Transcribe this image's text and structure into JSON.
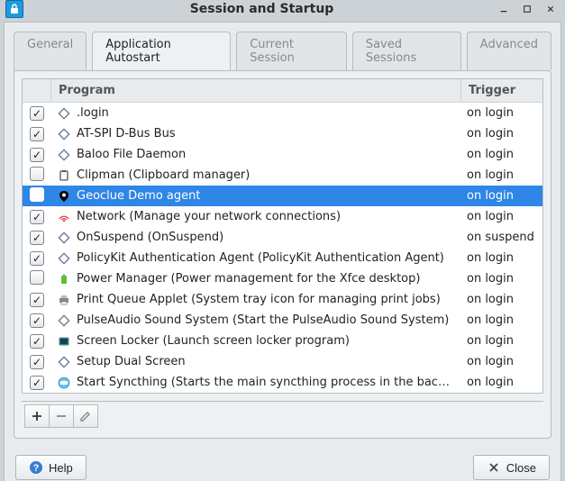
{
  "window": {
    "title": "Session and Startup"
  },
  "tabs": [
    {
      "label": "General",
      "active": false
    },
    {
      "label": "Application Autostart",
      "active": true
    },
    {
      "label": "Current Session",
      "active": false
    },
    {
      "label": "Saved Sessions",
      "active": false
    },
    {
      "label": "Advanced",
      "active": false
    }
  ],
  "columns": {
    "program": "Program",
    "trigger": "Trigger"
  },
  "rows": [
    {
      "checked": true,
      "icon": "generic",
      "label": ".login",
      "trigger": "on login",
      "selected": false
    },
    {
      "checked": true,
      "icon": "generic",
      "label": "AT-SPI D-Bus Bus",
      "trigger": "on login",
      "selected": false
    },
    {
      "checked": true,
      "icon": "generic",
      "label": "Baloo File Daemon",
      "trigger": "on login",
      "selected": false
    },
    {
      "checked": false,
      "icon": "clipman",
      "label": "Clipman (Clipboard manager)",
      "trigger": "on login",
      "selected": false
    },
    {
      "checked": false,
      "icon": "geoclue",
      "label": "Geoclue Demo agent",
      "trigger": "on login",
      "selected": true
    },
    {
      "checked": true,
      "icon": "network",
      "label": "Network (Manage your network connections)",
      "trigger": "on login",
      "selected": false
    },
    {
      "checked": true,
      "icon": "generic",
      "label": "OnSuspend (OnSuspend)",
      "trigger": "on suspend",
      "selected": false
    },
    {
      "checked": true,
      "icon": "generic",
      "label": "PolicyKit Authentication Agent (PolicyKit Authentication Agent)",
      "trigger": "on login",
      "selected": false
    },
    {
      "checked": false,
      "icon": "power",
      "label": "Power Manager (Power management for the Xfce desktop)",
      "trigger": "on login",
      "selected": false
    },
    {
      "checked": true,
      "icon": "printer",
      "label": "Print Queue Applet (System tray icon for managing print jobs)",
      "trigger": "on login",
      "selected": false
    },
    {
      "checked": true,
      "icon": "generic",
      "label": "PulseAudio Sound System (Start the PulseAudio Sound System)",
      "trigger": "on login",
      "selected": false
    },
    {
      "checked": true,
      "icon": "lock",
      "label": "Screen Locker (Launch screen locker program)",
      "trigger": "on login",
      "selected": false
    },
    {
      "checked": true,
      "icon": "generic",
      "label": "Setup Dual Screen",
      "trigger": "on login",
      "selected": false
    },
    {
      "checked": true,
      "icon": "sync",
      "label": "Start Syncthing (Starts the main syncthing process in the backg…",
      "trigger": "on login",
      "selected": false
    }
  ],
  "buttons": {
    "help": "Help",
    "close": "Close"
  }
}
